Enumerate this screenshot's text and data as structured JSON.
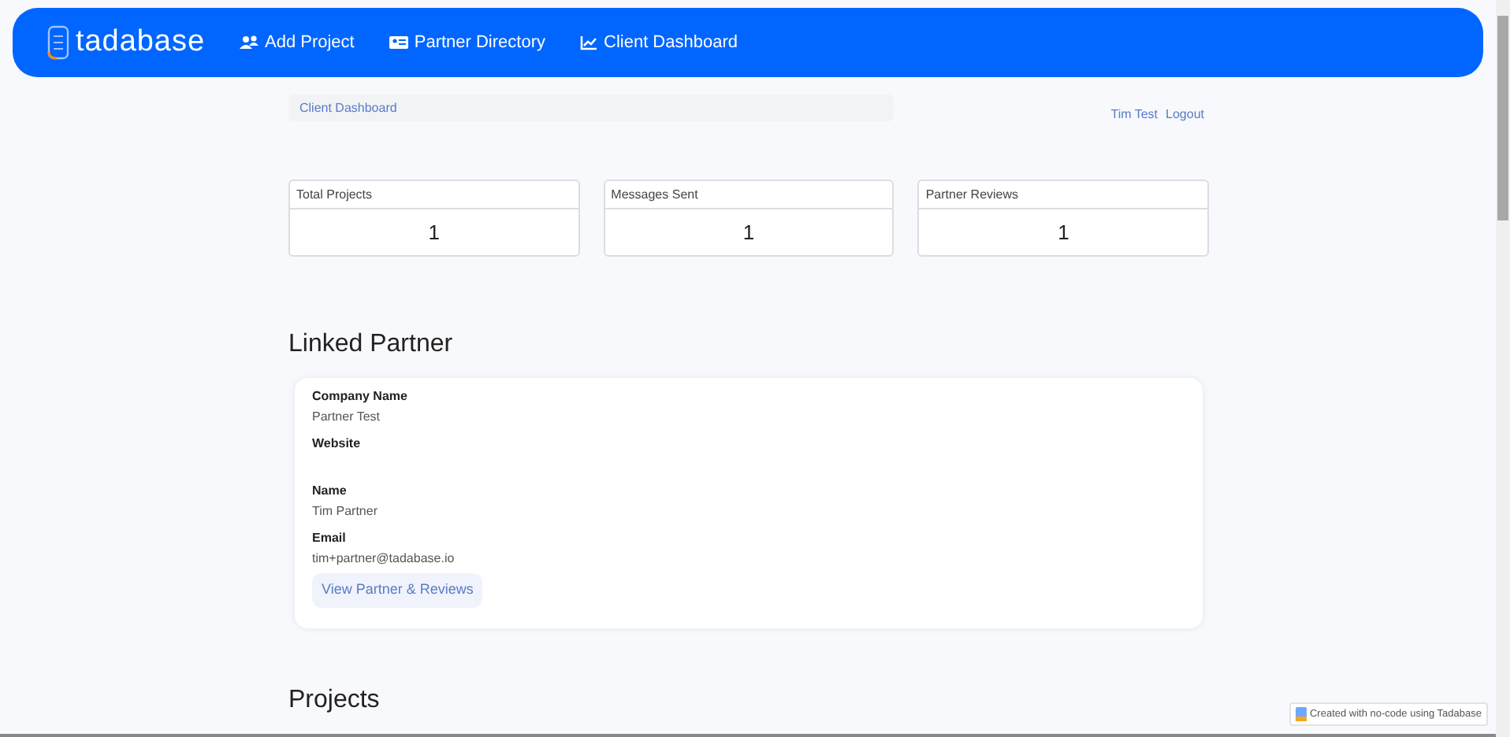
{
  "brand": "tadabase",
  "nav": [
    {
      "label": "Add Project"
    },
    {
      "label": "Partner Directory"
    },
    {
      "label": "Client Dashboard"
    }
  ],
  "breadcrumb": "Client Dashboard",
  "user_links": [
    "Tim Test",
    "Logout"
  ],
  "stats": [
    {
      "label": "Total Projects",
      "value": "1"
    },
    {
      "label": "Messages Sent",
      "value": "1"
    },
    {
      "label": "Partner Reviews",
      "value": "1"
    }
  ],
  "linked_partner": {
    "title": "Linked Partner",
    "fields": [
      {
        "label": "Company Name",
        "value": "Partner Test"
      },
      {
        "label": "Website"
      },
      {
        "label": "Name",
        "value": "Tim Partner"
      },
      {
        "label": "Email",
        "value": "tim+partner@tadabase.io"
      }
    ],
    "button": "View Partner & Reviews"
  },
  "projects_title": "Projects",
  "footer_badge": "Created with no-code using Tadabase"
}
